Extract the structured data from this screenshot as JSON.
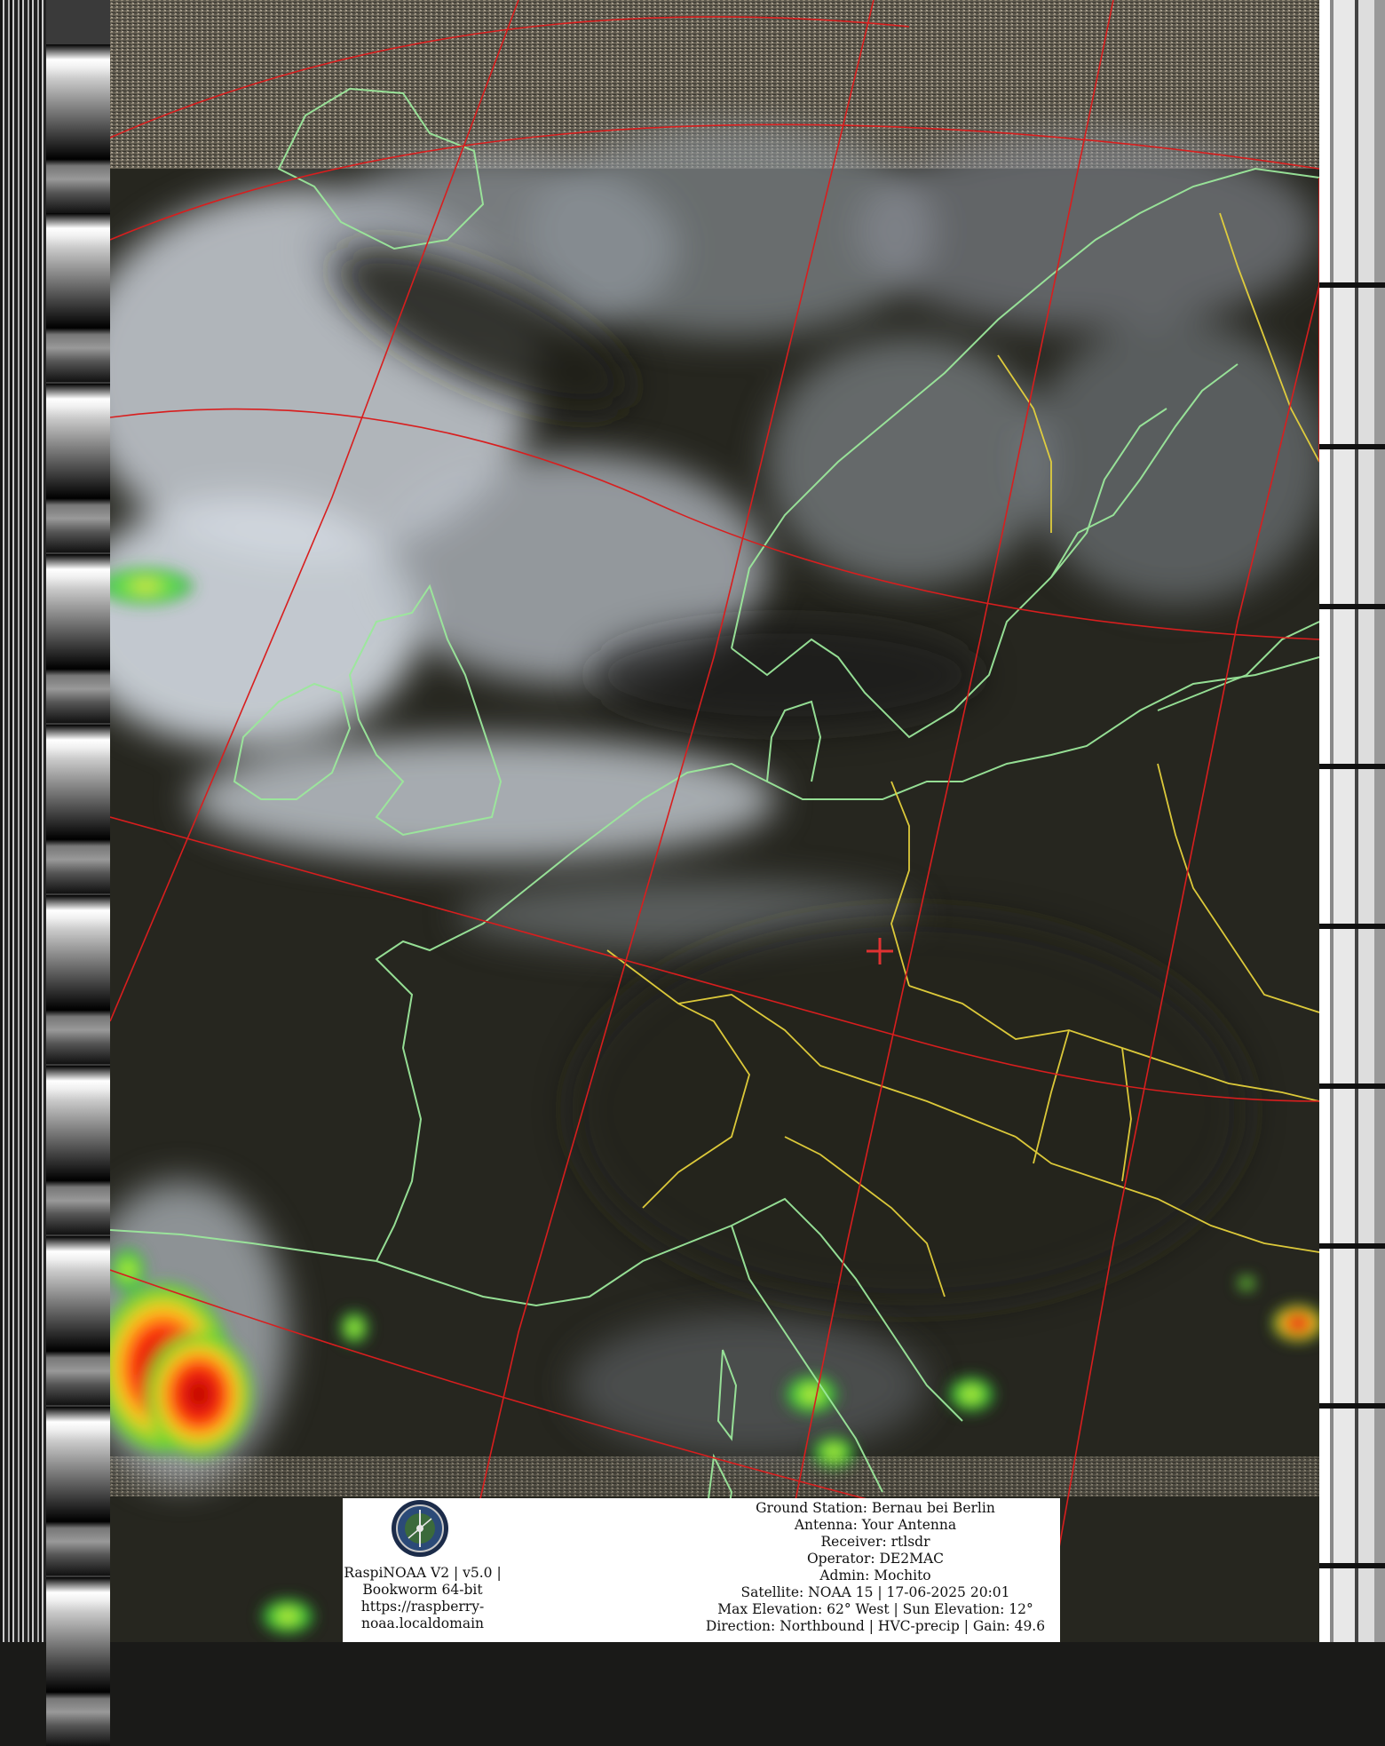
{
  "software": {
    "lines": [
      "RaspiNOAA V2 | v5.0 |",
      "Bookworm 64-bit",
      "https://raspberry-",
      "noaa.localdomain"
    ]
  },
  "pass_info": {
    "ground_station": "Ground Station: Bernau bei Berlin",
    "antenna": "Antenna: Your Antenna",
    "receiver": "Receiver: rtlsdr",
    "operator": "Operator: DE2MAC",
    "admin": "Admin: Mochito",
    "satellite": "Satellite: NOAA 15 | 17-06-2025 20:01",
    "elevation": "Max Elevation: 62° West | Sun Elevation: 12°",
    "direction": "Direction: Northbound | HVC-precip | Gain: 49.6"
  },
  "overlay_colors": {
    "graticule": "#d81e1e",
    "coastlines": "#9be89b",
    "borders": "#e6d23c",
    "station_marker": "#e03232",
    "precip_low": "#3fdc3f",
    "precip_high": "#e81e14"
  },
  "icons": [
    "station-logo-icon",
    "station-marker-icon"
  ]
}
